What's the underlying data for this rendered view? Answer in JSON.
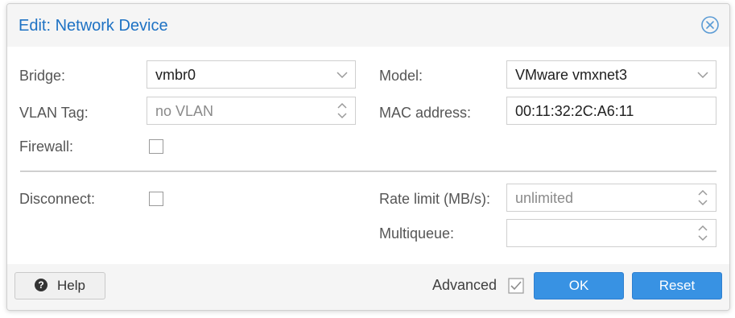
{
  "dialog": {
    "title": "Edit: Network Device"
  },
  "form": {
    "bridge": {
      "label": "Bridge:",
      "value": "vmbr0"
    },
    "vlan_tag": {
      "label": "VLAN Tag:",
      "placeholder": "no VLAN"
    },
    "firewall": {
      "label": "Firewall:",
      "checked": false
    },
    "model": {
      "label": "Model:",
      "value": "VMware vmxnet3"
    },
    "mac_address": {
      "label": "MAC address:",
      "value": "00:11:32:2C:A6:11"
    },
    "disconnect": {
      "label": "Disconnect:",
      "checked": false
    },
    "rate_limit": {
      "label": "Rate limit (MB/s):",
      "placeholder": "unlimited"
    },
    "multiqueue": {
      "label": "Multiqueue:",
      "value": ""
    }
  },
  "footer": {
    "help_label": "Help",
    "advanced_label": "Advanced",
    "advanced_checked": true,
    "ok_label": "OK",
    "reset_label": "Reset"
  },
  "colors": {
    "title": "#1e72c4",
    "primary_button": "#3892e3",
    "dialog_background": "#f5f5f5"
  }
}
